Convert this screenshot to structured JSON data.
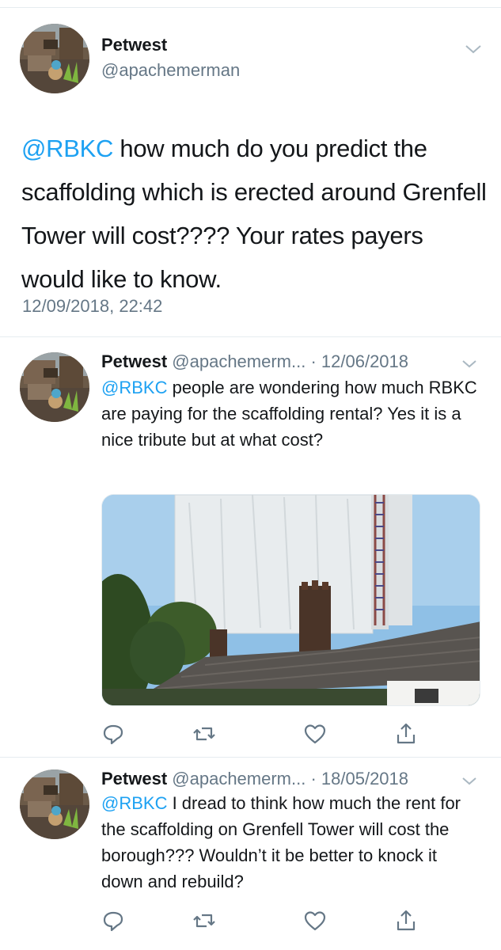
{
  "main_tweet": {
    "name": "Petwest",
    "handle": "@apachemerman",
    "mention": "@RBKC",
    "text": " how much do you predict the scaffolding which is erected around Grenfell Tower will cost????  Your rates payers would like to know.",
    "timestamp": "12/09/2018, 22:42"
  },
  "replies": [
    {
      "name": "Petwest",
      "handle": "@apachemerm...",
      "separator": " · ",
      "date": "12/06/2018",
      "mention": "@RBKC",
      "text": " people are wondering how much RBKC are paying for the scaffolding rental? Yes it is a nice tribute but at what cost?",
      "has_media": true
    },
    {
      "name": "Petwest",
      "handle": "@apachemerm...",
      "separator": " · ",
      "date": "18/05/2018",
      "mention": "@RBKC",
      "text": " I dread to think how much the rent for the scaffolding on Grenfell Tower will cost the borough??? Wouldn’t it be better to knock it down and rebuild?",
      "has_media": false
    }
  ],
  "icons": {
    "reply": "reply-icon",
    "retweet": "retweet-icon",
    "like": "like-icon",
    "share": "share-icon",
    "more": "chevron-down-icon"
  },
  "colors": {
    "accent": "#1da1f2",
    "secondary_text": "#657786",
    "primary_text": "#14171a",
    "divider": "#e6ecf0"
  }
}
